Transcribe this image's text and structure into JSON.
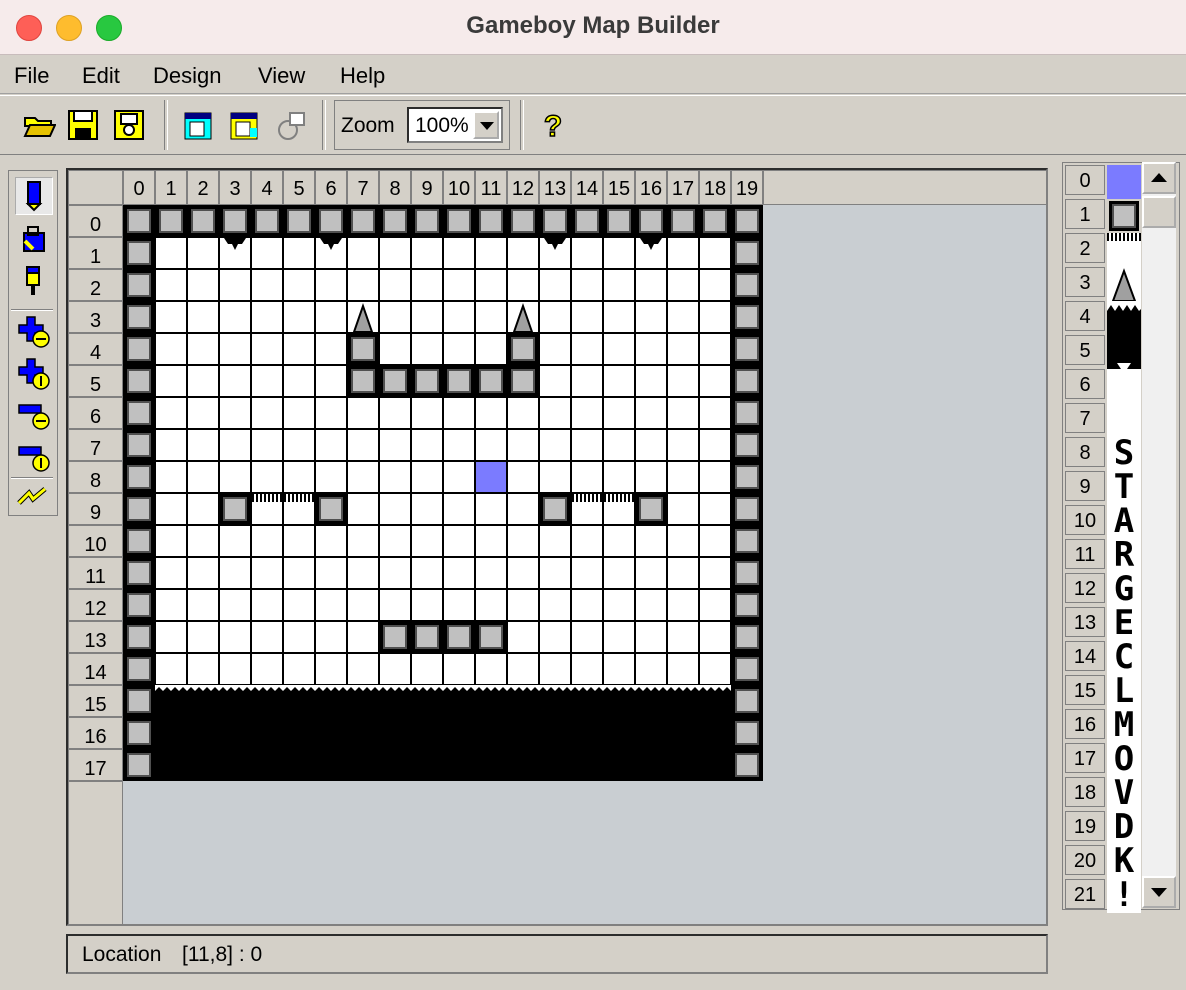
{
  "window": {
    "title": "Gameboy Map Builder"
  },
  "menu": [
    {
      "label": "File",
      "key": "F"
    },
    {
      "label": "Edit",
      "key": "E"
    },
    {
      "label": "Design",
      "key": "D"
    },
    {
      "label": "View",
      "key": "V"
    },
    {
      "label": "Help",
      "key": "H"
    }
  ],
  "toolbar": {
    "zoom_label": "Zoom",
    "zoom_value": "100%",
    "icons": [
      "open-folder-icon",
      "save-icon",
      "save-as-icon",
      "tile-properties-icon",
      "map-properties-icon",
      "rotate-icon",
      "help-icon"
    ]
  },
  "side_tools": [
    "pencil-icon",
    "bucket-fill-icon",
    "dropper-icon",
    "insert-row-icon",
    "insert-column-icon",
    "delete-row-icon",
    "delete-column-icon",
    "zigzag-icon"
  ],
  "grid": {
    "col_headers": [
      "0",
      "1",
      "2",
      "3",
      "4",
      "5",
      "6",
      "7",
      "8",
      "9",
      "10",
      "11",
      "12",
      "13",
      "14",
      "15",
      "16",
      "17",
      "18",
      "19"
    ],
    "row_headers": [
      "0",
      "1",
      "2",
      "3",
      "4",
      "5",
      "6",
      "7",
      "8",
      "9",
      "10",
      "11",
      "12",
      "13",
      "14",
      "15",
      "16",
      "17"
    ],
    "selected_cell": [
      11,
      8
    ],
    "colors": {
      "wall": "#c0c0c0",
      "floor": "#ffffff",
      "selected": "#7b7bff",
      "ground": "#000000"
    }
  },
  "status": {
    "label": "Location",
    "value": "[11,8] : 0"
  },
  "palette": {
    "indices": [
      "0",
      "1",
      "2",
      "3",
      "4",
      "5",
      "6",
      "7",
      "8",
      "9",
      "10",
      "11",
      "12",
      "13",
      "14",
      "15",
      "16",
      "17",
      "18",
      "19",
      "20",
      "21"
    ],
    "letters": [
      "S",
      "T",
      "A",
      "R",
      "G",
      "E",
      "C",
      "L",
      "M",
      "O",
      "V",
      "D",
      "K",
      "!"
    ]
  }
}
